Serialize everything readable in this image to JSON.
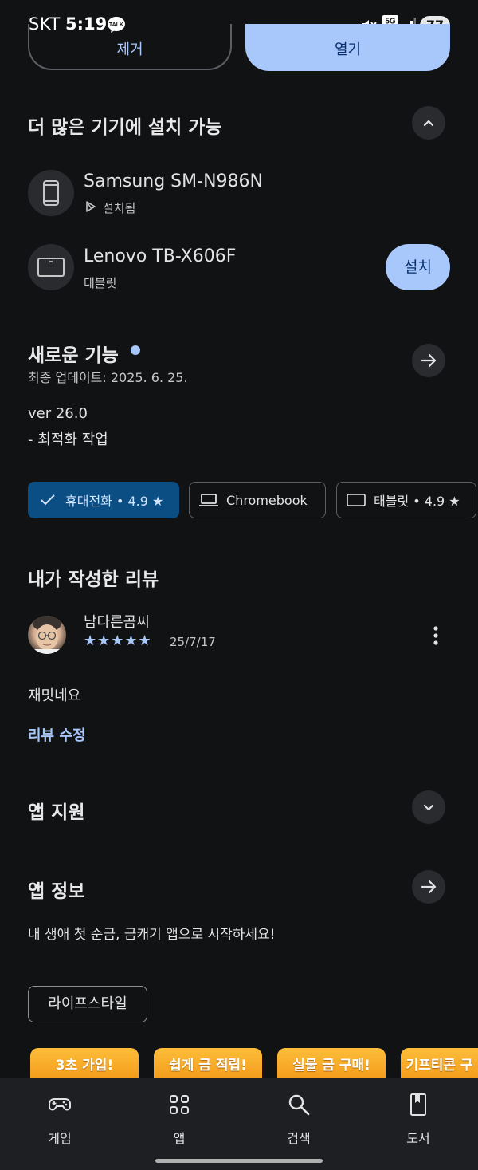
{
  "status_bar": {
    "carrier": "SKT",
    "time": "5:19",
    "talk_label": "TALK",
    "network": "5G",
    "battery": "77"
  },
  "actions": {
    "remove_label": "제거",
    "open_label": "열기"
  },
  "more_devices": {
    "title": "더 많은 기기에 설치 가능",
    "devices": [
      {
        "name": "Samsung SM-N986N",
        "status": "설치됨",
        "icon": "phone-icon"
      },
      {
        "name": "Lenovo TB-X606F",
        "status": "태블릿",
        "icon": "tablet-icon",
        "action": "설치"
      }
    ]
  },
  "whats_new": {
    "title": "새로운 기능",
    "updated": "최종 업데이트: 2025. 6. 25.",
    "version": "ver 26.0",
    "note": "- 최적화 작업"
  },
  "rating_chips": [
    {
      "label": "휴대전화 • 4.9 ★",
      "icon": "check-icon",
      "selected": true
    },
    {
      "label": "Chromebook",
      "icon": "laptop-icon",
      "selected": false
    },
    {
      "label": "태블릿 • 4.9 ★",
      "icon": "tablet-icon",
      "selected": false
    }
  ],
  "my_review": {
    "title": "내가 작성한 리뷰",
    "author": "남다른곰씨",
    "stars": 5,
    "date": "25/7/17",
    "text": "재밋네요",
    "edit_label": "리뷰 수정"
  },
  "app_support": {
    "title": "앱 지원"
  },
  "app_info": {
    "title": "앱 정보",
    "description": "내 생애 첫 순금, 금캐기 앱으로 시작하세요!",
    "category": "라이프스타일"
  },
  "banners": [
    "3초 가입!",
    "쉽게 금 적립!",
    "실물 금 구매!",
    "기프티콘 구"
  ],
  "bottom_nav": [
    {
      "label": "게임",
      "icon": "gamepad-icon"
    },
    {
      "label": "앱",
      "icon": "apps-grid-icon"
    },
    {
      "label": "검색",
      "icon": "search-icon"
    },
    {
      "label": "도서",
      "icon": "book-icon"
    }
  ],
  "colors": {
    "background": "#111214",
    "accent": "#a8c7fa",
    "selected_chip": "#0b4e83",
    "banner": "#f5a623"
  }
}
